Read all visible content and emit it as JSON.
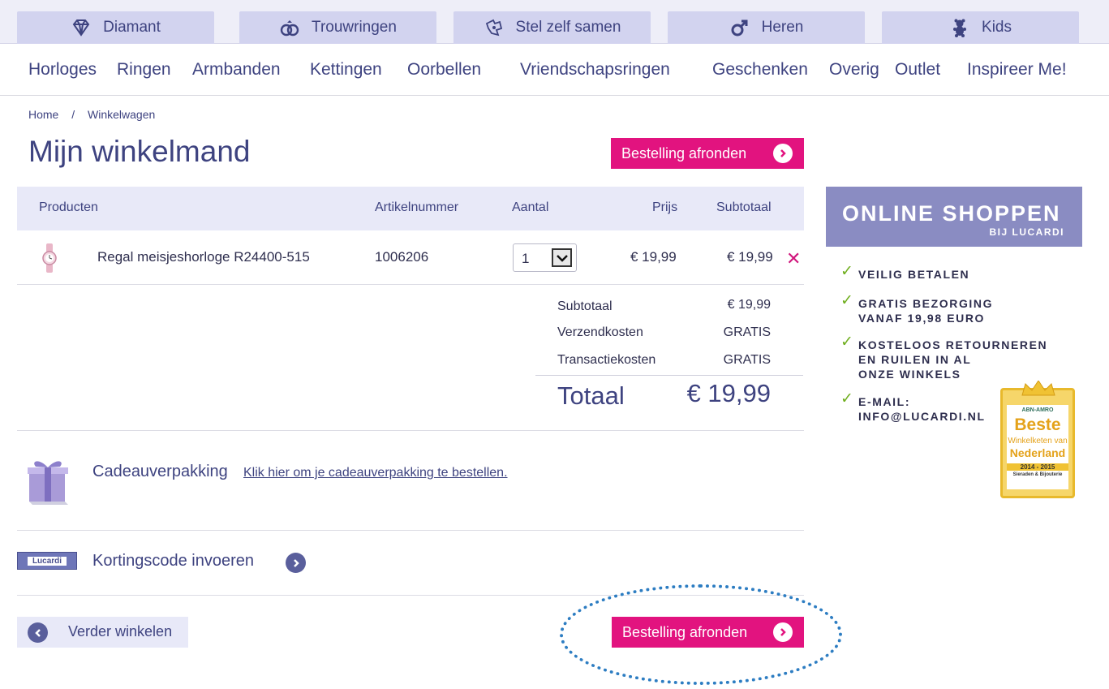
{
  "top_tabs": [
    {
      "label": "Diamant",
      "icon": "diamond-icon"
    },
    {
      "label": "Trouwringen",
      "icon": "rings-icon"
    },
    {
      "label": "Stel zelf samen",
      "icon": "puzzle-icon"
    },
    {
      "label": "Heren",
      "icon": "male-icon"
    },
    {
      "label": "Kids",
      "icon": "teddy-bear-icon"
    }
  ],
  "main_nav": [
    "Horloges",
    "Ringen",
    "Armbanden",
    "Kettingen",
    "Oorbellen",
    "Vriendschapsringen",
    "Geschenken",
    "Overig",
    "Outlet",
    "Inspireer Me!"
  ],
  "breadcrumb": {
    "home": "Home",
    "separator": "/",
    "current": "Winkelwagen"
  },
  "page_title": "Mijn winkelmand",
  "checkout_label": "Bestelling afronden",
  "table": {
    "headers": {
      "product": "Producten",
      "sku": "Artikelnummer",
      "qty": "Aantal",
      "price": "Prijs",
      "subtotal": "Subtotaal"
    },
    "rows": [
      {
        "name": "Regal meisjeshorloge R24400-515",
        "sku": "1006206",
        "qty": "1",
        "price": "€ 19,99",
        "subtotal": "€ 19,99"
      }
    ]
  },
  "totals": {
    "subtotal_label": "Subtotaal",
    "subtotal_value": "€ 19,99",
    "shipping_label": "Verzendkosten",
    "shipping_value": "GRATIS",
    "transaction_label": "Transactiekosten",
    "transaction_value": "GRATIS",
    "total_label": "Totaal",
    "total_value": "€ 19,99"
  },
  "gift": {
    "title": "Cadeauverpakking",
    "link": "Klik hier om je cadeauverpakking te bestellen."
  },
  "coupon": {
    "title": "Kortingscode invoeren",
    "card_text": "Lucardi"
  },
  "back_label": "Verder winkelen",
  "sidebar": {
    "banner_title": "ONLINE SHOPPEN",
    "banner_sub": "BIJ LUCARDI",
    "usps": [
      [
        "VEILIG BETALEN"
      ],
      [
        "GRATIS BEZORGING",
        "VANAF 19,98 EURO"
      ],
      [
        "KOSTELOOS RETOURNEREN",
        "EN RUILEN  IN AL",
        "ONZE WINKELS"
      ],
      [
        "E-MAIL:",
        "INFO@LUCARDI.NL"
      ]
    ],
    "award": {
      "top": "ABN-AMRO",
      "title": "Beste",
      "line1": "Winkelketen van",
      "line2": "Nederland",
      "years": "2014 - 2015",
      "category": "Sieraden & Bijouterie"
    }
  },
  "colors": {
    "accent_pink": "#e2137f",
    "brand_purple": "#3e4380",
    "tab_bg": "#d2d3ef",
    "check_green": "#6fae1e"
  }
}
